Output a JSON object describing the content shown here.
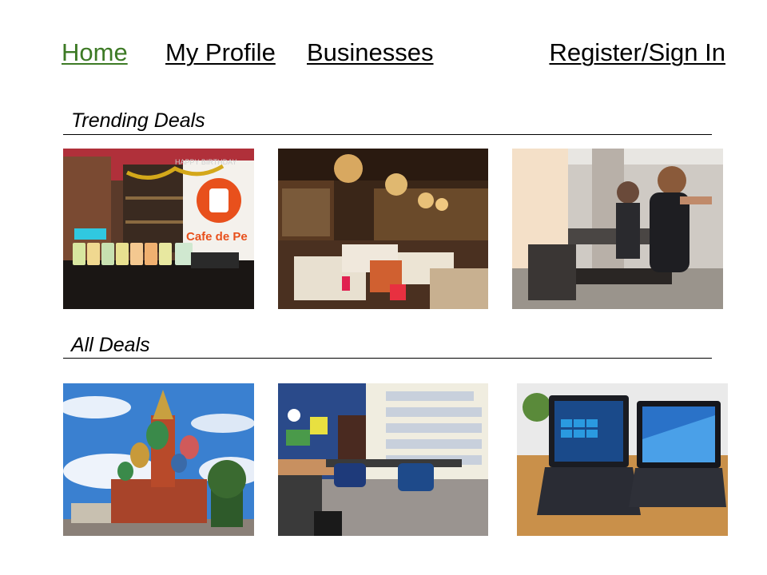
{
  "nav": {
    "home": "Home",
    "profile": "My Profile",
    "businesses": "Businesses",
    "register": "Register/Sign In"
  },
  "colors": {
    "active_link": "#3d7a25"
  },
  "trending": {
    "title": "Trending Deals",
    "items": [
      {
        "icon": "cafe-bubble-tea-photo",
        "sign_text": "Cafe de Pe",
        "banner_text": "HAPPY BIRTHDAY"
      },
      {
        "icon": "restaurant-interior-photo"
      },
      {
        "icon": "gym-treadmill-photo"
      }
    ]
  },
  "all": {
    "title": "All  Deals",
    "items": [
      {
        "icon": "cathedral-landmark-photo"
      },
      {
        "icon": "classroom-office-photo"
      },
      {
        "icon": "laptops-photo"
      }
    ]
  }
}
